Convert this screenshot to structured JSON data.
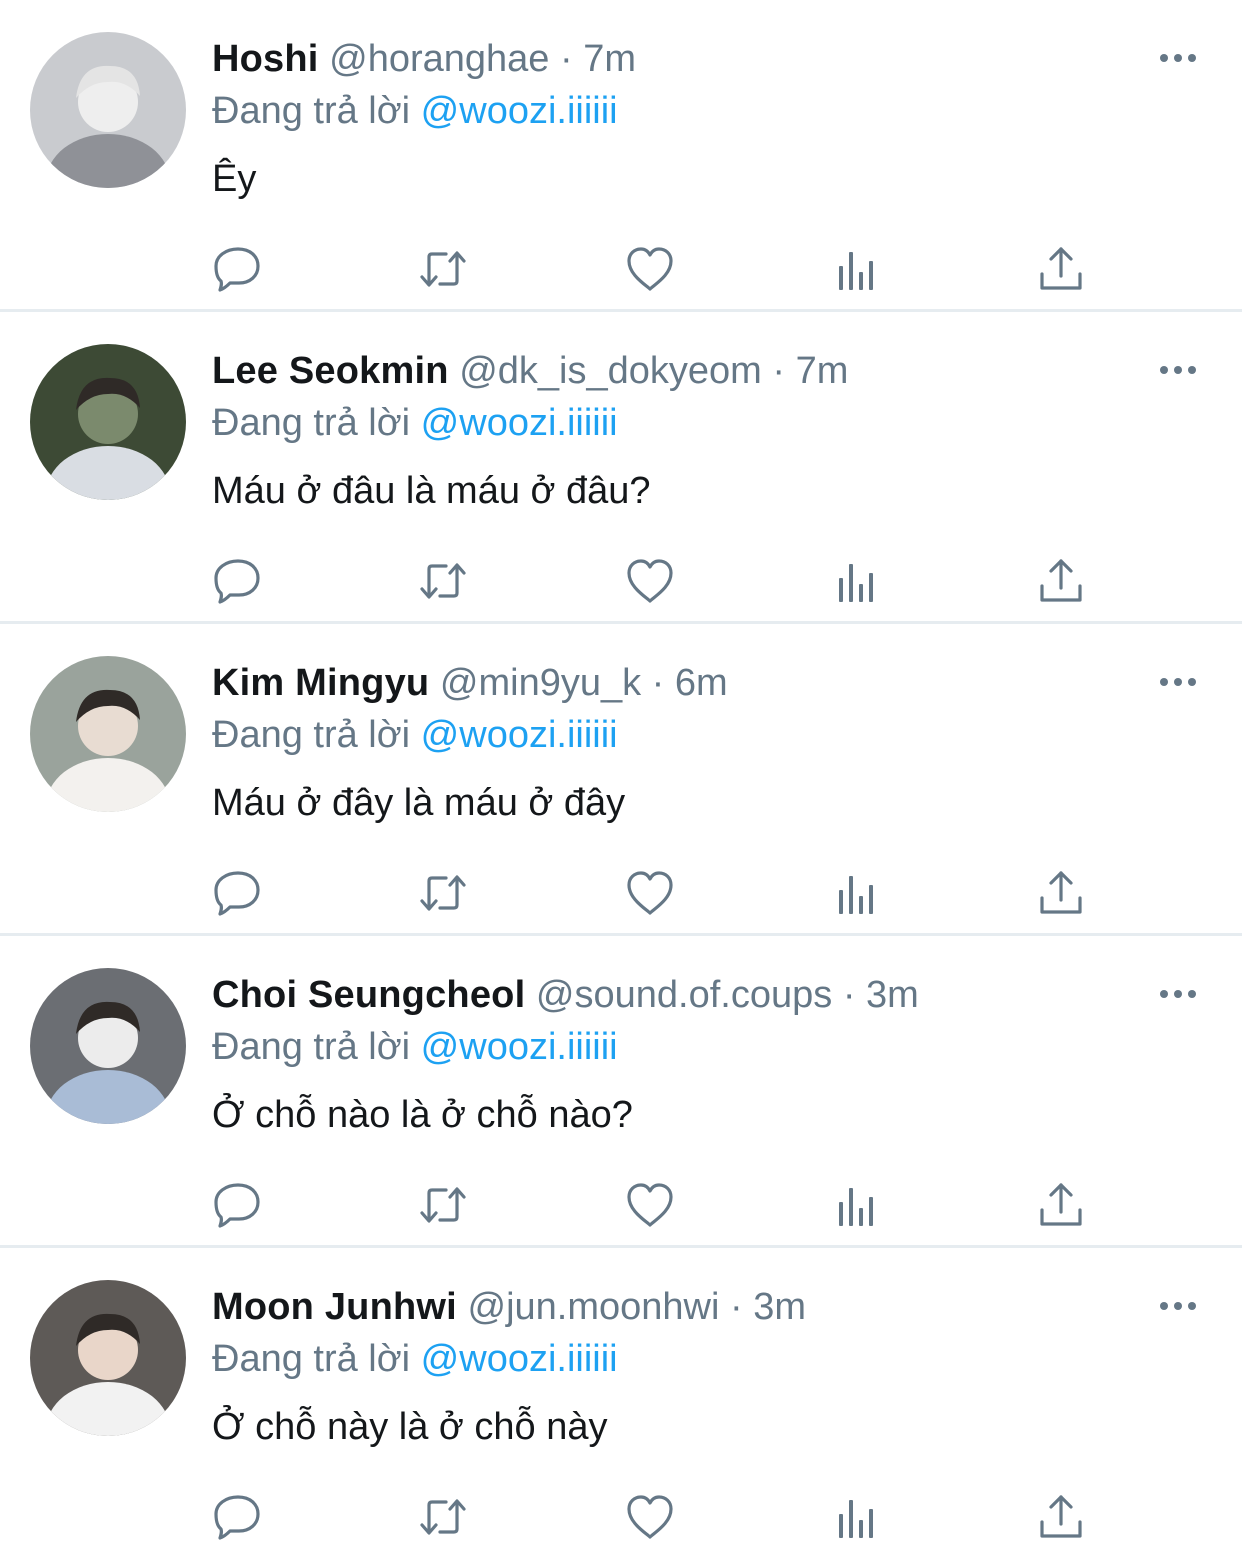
{
  "icon_color": "#657786",
  "tweets": [
    {
      "name": "Hoshi",
      "handle": "@horanghae",
      "separator": "·",
      "time": "7m",
      "reply_prefix": "Đang trả lời",
      "reply_to": "@woozi.iiiiii",
      "text": "Êy",
      "avatar_palette": [
        "#c9cbcf",
        "#eeeeee",
        "#8f9197"
      ]
    },
    {
      "name": "Lee Seokmin",
      "handle": "@dk_is_dokyeom",
      "separator": "·",
      "time": "7m",
      "reply_prefix": "Đang trả lời",
      "reply_to": "@woozi.iiiiii",
      "text": "Máu ở đâu là máu ở đâu?",
      "avatar_palette": [
        "#3d4a35",
        "#7b8a6d",
        "#d9dde3"
      ]
    },
    {
      "name": "Kim Mingyu",
      "handle": "@min9yu_k",
      "separator": "·",
      "time": "6m",
      "reply_prefix": "Đang trả lời",
      "reply_to": "@woozi.iiiiii",
      "text": "Máu ở đây là máu ở đây",
      "avatar_palette": [
        "#9aa39c",
        "#e8dcd2",
        "#f3f1ee"
      ]
    },
    {
      "name": "Choi Seungcheol",
      "handle": "@sound.of.coups",
      "separator": "·",
      "time": "3m",
      "reply_prefix": "Đang trả lời",
      "reply_to": "@woozi.iiiiii",
      "text": "Ở chỗ nào là ở chỗ nào?",
      "avatar_palette": [
        "#6b6e73",
        "#ececec",
        "#a9bcd6"
      ]
    },
    {
      "name": "Moon Junhwi",
      "handle": "@jun.moonhwi",
      "separator": "·",
      "time": "3m",
      "reply_prefix": "Đang trả lời",
      "reply_to": "@woozi.iiiiii",
      "text": "Ở chỗ này là ở chỗ này",
      "avatar_palette": [
        "#5e5a57",
        "#e9d6c9",
        "#f2f2f2"
      ]
    }
  ]
}
